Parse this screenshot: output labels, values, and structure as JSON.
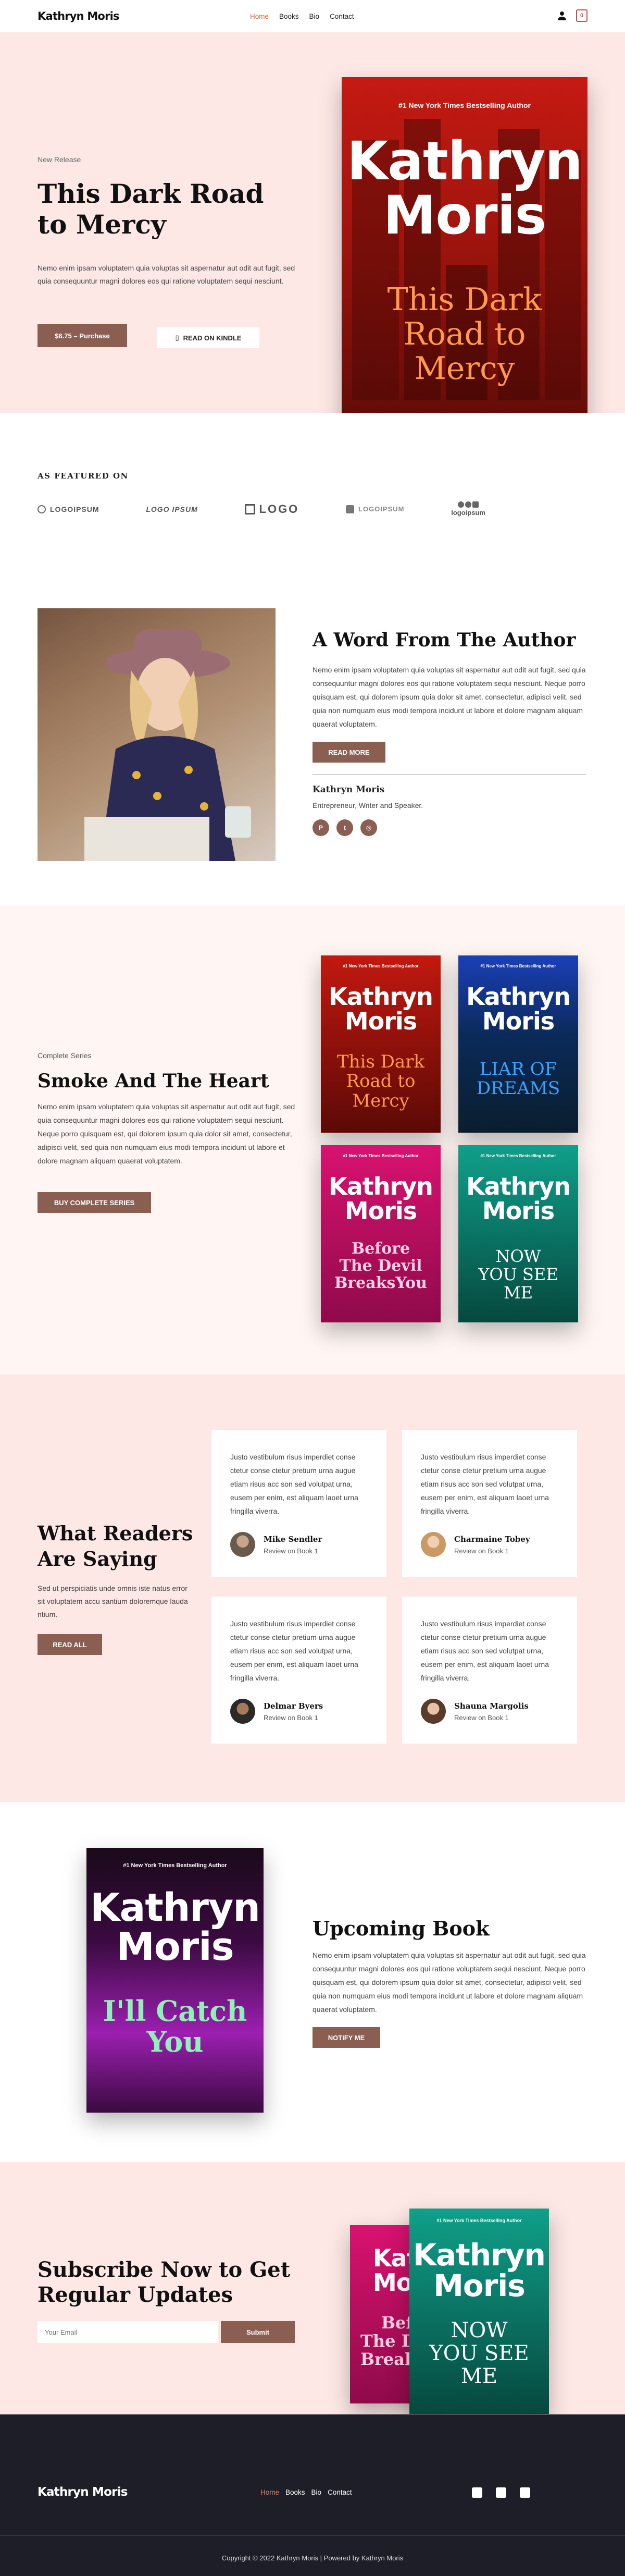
{
  "header": {
    "logo": "Kathryn Moris",
    "nav": [
      "Home",
      "Books",
      "Bio",
      "Contact"
    ],
    "active": "Home",
    "cart_count": "0"
  },
  "hero": {
    "eyebrow": "New Release",
    "title": "This Dark Road to Mercy",
    "description": "Nemo enim ipsam voluptatem quia voluptas sit aspernatur aut odit aut fugit, sed quia consequuntur magni dolores eos qui ratione voluptatem sequi nesciunt.",
    "buy_label": "$6.75 – Purchase",
    "kindle_label": "READ ON KINDLE",
    "book": {
      "tagline": "#1 New York Times Bestselling Author",
      "author_line1": "Kathryn",
      "author_line2": "Moris",
      "title_line1": "This Dark",
      "title_line2": "Road to",
      "title_line3": "Mercy"
    }
  },
  "featured": {
    "heading": "AS FEATURED ON",
    "logos": [
      "LOGOIPSUM",
      "LOGO IPSUM",
      "LOGO",
      "LOGOIPSUM",
      "logoipsum"
    ]
  },
  "author": {
    "heading": "A Word From The Author",
    "description": "Nemo enim ipsam voluptatem quia voluptas sit aspernatur aut odit aut fugit, sed quia consequuntur magni dolores eos qui ratione voluptatem sequi nesciunt. Neque porro quisquam est, qui dolorem ipsum quia dolor sit amet, consectetur, adipisci velit, sed quia non numquam eius modi tempora incidunt ut labore et dolore magnam aliquam quaerat voluptatem.",
    "button": "READ MORE",
    "name": "Kathryn Moris",
    "role": "Entrepreneur, Writer and Speaker."
  },
  "series": {
    "eyebrow": "Complete Series",
    "heading": "Smoke And The Heart",
    "description": "Nemo enim ipsam voluptatem quia voluptas sit aspernatur aut odit aut fugit, sed quia consequuntur magni dolores eos qui ratione voluptatem sequi nesciunt. Neque porro quisquam est, qui dolorem ipsum quia dolor sit amet, consectetur, adipisci velit, sed quia non numquam eius modi tempora incidunt ut labore et dolore magnam aliquam quaerat voluptatem.",
    "button": "BUY COMPLETE SERIES",
    "books": [
      {
        "tag": "#1 New York Times Bestselling Author",
        "a1": "Kathryn",
        "a2": "Moris",
        "t1": "This Dark",
        "t2": "Road to",
        "t3": "Mercy"
      },
      {
        "tag": "#1 New York Times Bestselling Author",
        "a1": "Kathryn",
        "a2": "Moris",
        "t1": "LIAR OF",
        "t2": "DREAMS",
        "t3": ""
      },
      {
        "tag": "#1 New York Times Bestselling Author",
        "a1": "Kathryn",
        "a2": "Moris",
        "t1": "Before",
        "t2": "The Devil",
        "t3": "BreaksYou"
      },
      {
        "tag": "#1 New York Times Bestselling Author",
        "a1": "Kathryn",
        "a2": "Moris",
        "t1": "NOW",
        "t2": "YOU SEE",
        "t3": "ME"
      }
    ]
  },
  "testimonials": {
    "heading": "What Readers Are Saying",
    "description": "Sed ut perspiciatis unde omnis iste natus error sit voluptatem accu santium doloremque lauda ntium.",
    "button": "READ ALL",
    "items": [
      {
        "quote": "Justo vestibulum risus imperdiet conse ctetur conse ctetur pretium urna augue etiam risus acc son sed volutpat urna, eusem per enim, est aliquam laoet urna fringilla viverra.",
        "name": "Mike Sendler",
        "review": "Review on Book 1"
      },
      {
        "quote": "Justo vestibulum risus imperdiet conse ctetur conse ctetur pretium urna augue etiam risus acc son sed volutpat urna, eusem per enim, est aliquam laoet urna fringilla viverra.",
        "name": "Charmaine Tobey",
        "review": "Review on Book 1"
      },
      {
        "quote": "Justo vestibulum risus imperdiet conse ctetur conse ctetur pretium urna augue etiam risus acc son sed volutpat urna, eusem per enim, est aliquam laoet urna fringilla viverra.",
        "name": "Delmar Byers",
        "review": "Review on Book 1"
      },
      {
        "quote": "Justo vestibulum risus imperdiet conse ctetur conse ctetur pretium urna augue etiam risus acc son sed volutpat urna, eusem per enim, est aliquam laoet urna fringilla viverra.",
        "name": "Shauna Margolis",
        "review": "Review on Book 1"
      }
    ]
  },
  "upcoming": {
    "heading": "Upcoming Book",
    "description": "Nemo enim ipsam voluptatem quia voluptas sit aspernatur aut odit aut fugit, sed quia consequuntur magni dolores eos qui ratione voluptatem sequi nesciunt. Neque porro quisquam est, qui dolorem ipsum quia dolor sit amet, consectetur, adipisci velit, sed quia non numquam eius modi tempora incidunt ut labore et dolore magnam aliquam quaerat voluptatem.",
    "button": "NOTIFY ME",
    "book": {
      "tag": "#1 New York Times Bestselling Author",
      "a1": "Kathryn",
      "a2": "Moris",
      "t1": "I'll Catch",
      "t2": "You"
    }
  },
  "subscribe": {
    "heading": "Subscribe Now to Get Regular Updates",
    "placeholder": "Your Email",
    "button": "Submit",
    "back_book": {
      "a1": "Kat",
      "a2": "Mo",
      "t1": "Bef",
      "t2": "The D",
      "t3": "Break"
    },
    "front_book": {
      "tag": "#1 New York Times Bestselling Author",
      "a1": "Kathryn",
      "a2": "Moris",
      "t1": "NOW",
      "t2": "YOU SEE",
      "t3": "ME"
    }
  },
  "footer": {
    "logo": "Kathryn Moris",
    "nav": [
      "Home",
      "Books",
      "Bio",
      "Contact"
    ],
    "copyright": "Copyright © 2022 Kathryn Moris | Powered by Kathryn Moris"
  },
  "colors": {
    "accent_brown": "#8b5e52",
    "hero_bg": "#fde8e5",
    "active_link": "#d36a4f",
    "footer_bg": "#1e1e29"
  }
}
